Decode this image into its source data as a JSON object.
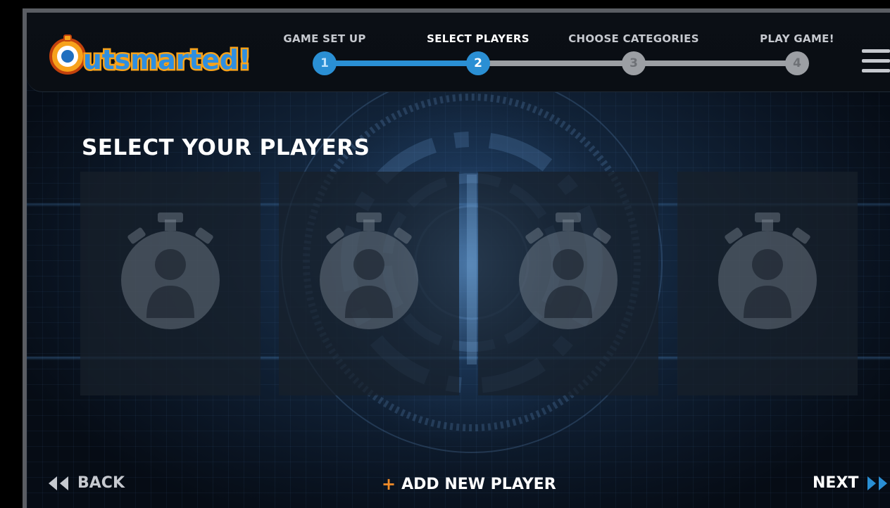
{
  "app": {
    "logo_text": "Outsmarted!"
  },
  "stepper": {
    "steps": [
      {
        "label": "GAME SET UP",
        "number": "1",
        "state": "done"
      },
      {
        "label": "SELECT PLAYERS",
        "number": "2",
        "state": "current"
      },
      {
        "label": "CHOOSE CATEGORIES",
        "number": "3",
        "state": "todo"
      },
      {
        "label": "PLAY GAME!",
        "number": "4",
        "state": "todo"
      }
    ]
  },
  "main": {
    "title": "SELECT YOUR PLAYERS",
    "player_slots": [
      {
        "icon": "stopwatch-person-icon"
      },
      {
        "icon": "stopwatch-person-icon"
      },
      {
        "icon": "stopwatch-person-icon"
      },
      {
        "icon": "stopwatch-person-icon"
      }
    ]
  },
  "footer": {
    "back_label": "BACK",
    "add_plus": "+",
    "add_label": "ADD NEW PLAYER",
    "next_label": "NEXT"
  },
  "colors": {
    "accent_blue": "#2a8fd4",
    "inactive_gray": "#9c9fa4",
    "plus_orange": "#f28c28",
    "logo_orange": "#f7a21b"
  }
}
